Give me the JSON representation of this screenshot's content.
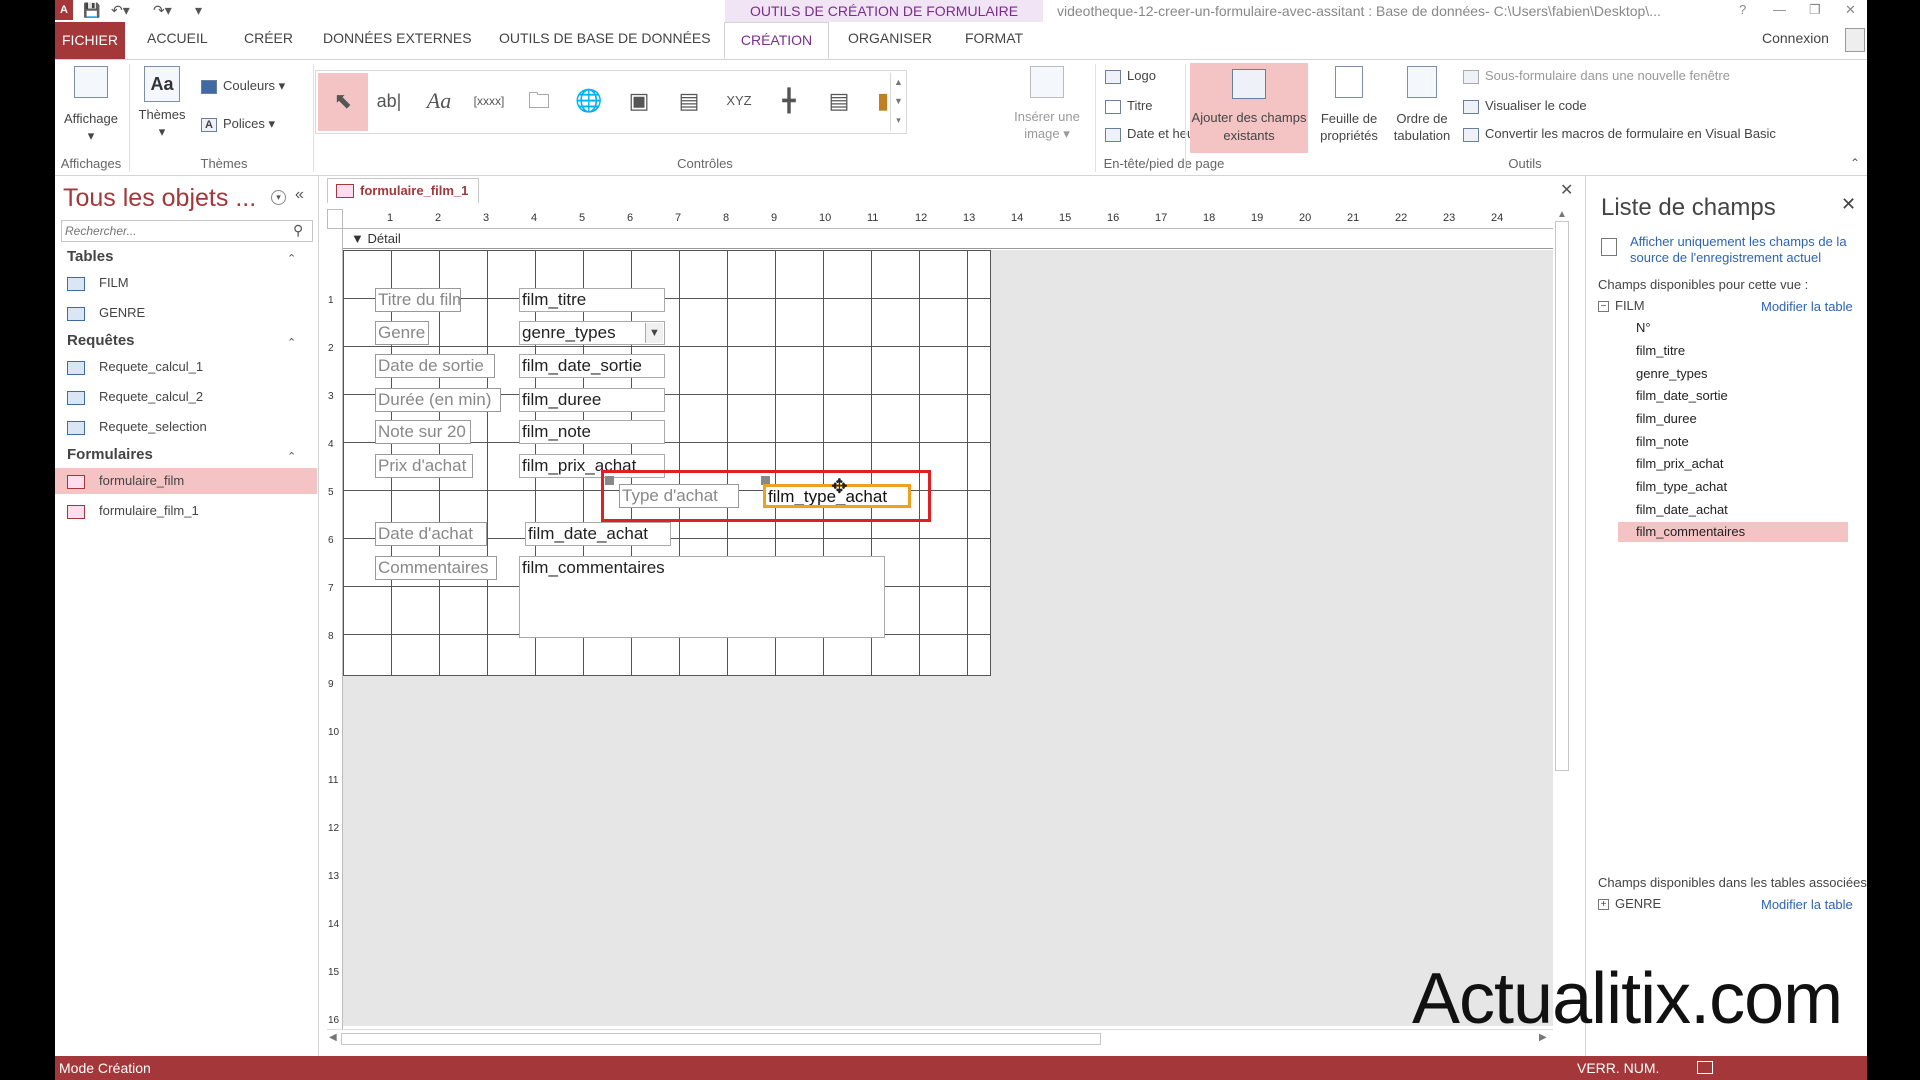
{
  "title_bar": {
    "context_title": "OUTILS DE CRÉATION DE FORMULAIRE",
    "window_title": "videotheque-12-creer-un-formulaire-avec-assitant : Base de données- C:\\Users\\fabien\\Desktop\\...",
    "help": "?",
    "minimize": "—",
    "restore": "❐",
    "close": "✕"
  },
  "tabs": {
    "fichier": "FICHIER",
    "accueil": "ACCUEIL",
    "creer": "CRÉER",
    "donnees_externes": "DONNÉES EXTERNES",
    "outils_bdd": "OUTILS DE BASE DE DONNÉES",
    "creation": "CRÉATION",
    "organiser": "ORGANISER",
    "format": "FORMAT",
    "connexion": "Connexion"
  },
  "ribbon": {
    "affichage": "Affichage",
    "affichages_group": "Affichages",
    "themes": "Thèmes",
    "couleurs": "Couleurs",
    "polices": "Polices",
    "themes_group": "Thèmes",
    "controles_group": "Contrôles",
    "inserer_image": "Insérer une image",
    "logo": "Logo",
    "titre": "Titre",
    "date_heure": "Date et heure",
    "entete_group": "En-tête/pied de page",
    "ajouter_champs": "Ajouter des champs existants",
    "feuille_proprietes": "Feuille de propriétés",
    "ordre_tabulation": "Ordre de tabulation",
    "sous_formulaire": "Sous-formulaire dans une nouvelle fenêtre",
    "visualiser_code": "Visualiser le code",
    "convertir_macros": "Convertir les macros de formulaire en Visual Basic",
    "outils_group": "Outils"
  },
  "nav": {
    "title": "Tous les objets ...",
    "search_placeholder": "Rechercher...",
    "tables_label": "Tables",
    "tables": [
      "FILM",
      "GENRE"
    ],
    "requetes_label": "Requêtes",
    "requetes": [
      "Requete_calcul_1",
      "Requete_calcul_2",
      "Requete_selection"
    ],
    "formulaires_label": "Formulaires",
    "formulaires": [
      "formulaire_film",
      "formulaire_film_1"
    ]
  },
  "document": {
    "tab_label": "formulaire_film_1",
    "section": "Détail",
    "ruler_numbers": [
      "1",
      "2",
      "3",
      "4",
      "5",
      "6",
      "7",
      "8",
      "9",
      "10",
      "11",
      "12",
      "13",
      "14",
      "15",
      "16",
      "17",
      "18",
      "19",
      "20",
      "21",
      "22",
      "23",
      "24"
    ],
    "vruler_numbers": [
      "1",
      "2",
      "3",
      "4",
      "5",
      "6",
      "7",
      "8",
      "9",
      "10",
      "11",
      "12",
      "13",
      "14",
      "15",
      "16"
    ],
    "labels": [
      "Titre du film",
      "Genre",
      "Date de sortie",
      "Durée (en min)",
      "Note sur 20",
      "Prix d'achat",
      "Type d'achat",
      "Date d'achat",
      "Commentaires"
    ],
    "fields": [
      "film_titre",
      "genre_types",
      "film_date_sortie",
      "film_duree",
      "film_note",
      "film_prix_achat",
      "film_type_achat",
      "film_date_achat",
      "film_commentaires"
    ]
  },
  "field_list": {
    "title": "Liste de champs",
    "show_only_link": "Afficher uniquement les champs de la source de l'enregistrement actuel",
    "available_label": "Champs disponibles pour cette vue :",
    "table_name": "FILM",
    "modify_link": "Modifier la table",
    "fields": [
      "N°",
      "film_titre",
      "genre_types",
      "film_date_sortie",
      "film_duree",
      "film_note",
      "film_prix_achat",
      "film_type_achat",
      "film_date_achat",
      "film_commentaires"
    ],
    "selected_index": 9,
    "related_label": "Champs disponibles dans les tables associées :",
    "related_table": "GENRE",
    "related_modify_link": "Modifier la table"
  },
  "status_bar": {
    "mode": "Mode Création",
    "verr_num": "VERR. NUM."
  },
  "watermark": "Actualitix.com",
  "colors": {
    "accent": "#a4373a",
    "selection": "#f4c4c5",
    "context_purple": "#7a2d8c",
    "highlight_box": "#e02020",
    "selected_control": "#f0a020"
  }
}
